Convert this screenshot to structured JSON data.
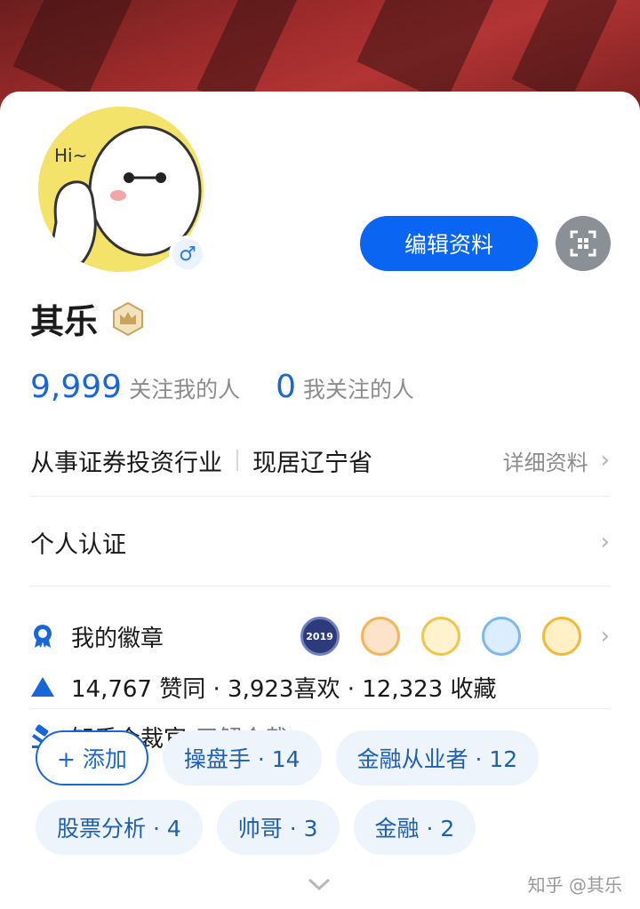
{
  "profile": {
    "name": "其乐",
    "gender_symbol": "♂",
    "edit_label": "编辑资料"
  },
  "follow": {
    "followers_count": "9,999",
    "followers_label": "关注我的人",
    "following_count": "0",
    "following_label": "我关注的人"
  },
  "info": {
    "industry": "从事证券投资行业",
    "location": "现居辽宁省",
    "detail_label": "详细资料"
  },
  "certification": {
    "label": "个人认证"
  },
  "badges": {
    "label": "我的徽章",
    "first_badge_text": "2019"
  },
  "stats": {
    "text": "14,767 赞同 · 3,923喜欢 · 12,323 收藏"
  },
  "judge": {
    "label": "知乎众裁官",
    "link": "了解众裁"
  },
  "tags": {
    "add_label": "+ 添加",
    "row1": [
      "操盘手 · 14",
      "金融从业者 · 12"
    ],
    "row2": [
      "股票分析 · 4",
      "帅哥 · 3",
      "金融 · 2"
    ]
  },
  "watermark": "知乎 @其乐",
  "colors": {
    "accent": "#0a66f2",
    "link_blue": "#1767d8",
    "muted": "#8c8c8c"
  }
}
